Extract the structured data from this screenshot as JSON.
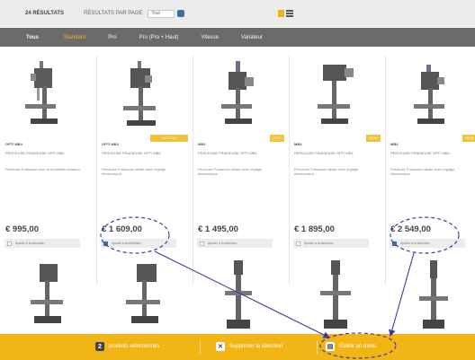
{
  "toolbar": {
    "result_count": "24 RÉSULTATS",
    "per_page_label": "RÉSULTATS PAR PAGE",
    "per_page_value": "Tout"
  },
  "nav": {
    "brand": "Tous",
    "tabs": [
      {
        "label": "Standard",
        "active": true
      },
      {
        "label": "Pro",
        "active": false
      },
      {
        "label": "Pro (Pro + Haut)",
        "active": false
      },
      {
        "label": "Vitesse",
        "active": false
      },
      {
        "label": "Variateur",
        "active": false
      }
    ]
  },
  "products": [
    {
      "name": "OPTI MB4",
      "code": "PERCEUSE FRAISEUSE OPTI MB4",
      "desc": "Perceuse Fraiseuse pour le modéliste amateur.",
      "badge": "",
      "price": "€ 995,00",
      "add_label": "Ajouter à la sélection",
      "selected": false
    },
    {
      "name": "OPTI MB4",
      "code": "PERCEUSE FRAISEUSE OPTI MB4",
      "desc": "Perceuse Fraiseuse idéale avec réglage électronique.",
      "badge": "ACTION",
      "price": "€ 1 609,00",
      "add_label": "Ajouter à la sélection",
      "selected": true
    },
    {
      "name": "MB4",
      "code": "PERCEUSE FRAISEUSE OPTI MB4",
      "desc": "Perceuse Fraiseuse idéale avec réglage électronique.",
      "badge": "NEW",
      "price": "€ 1 495,00",
      "add_label": "Ajouter à la sélection",
      "selected": false
    },
    {
      "name": "MB4",
      "code": "PERCEUSE FRAISEUSE OPTI MB4",
      "desc": "Perceuse Fraiseuse idéale avec réglage électronique.",
      "badge": "NEW",
      "price": "€ 1 895,00",
      "add_label": "Ajouter à la sélection",
      "selected": false
    },
    {
      "name": "MB4",
      "code": "PERCEUSE FRAISEUSE OPTI MB4",
      "desc": "Perceuse Fraiseuse idéale avec réglage électronique.",
      "badge": "NEW",
      "price": "€ 2 549,00",
      "add_label": "Ajouter à la sélection",
      "selected": true
    }
  ],
  "footer": {
    "selected_count": "2",
    "selected_label": "produits sélectionnés",
    "action1_label": "Supprimer la sélection",
    "action2_label": "Établir un devis"
  },
  "colors": {
    "accent": "#f2b516",
    "annotation": "#3a3aa8",
    "nav_bg": "#6b6b6b"
  }
}
